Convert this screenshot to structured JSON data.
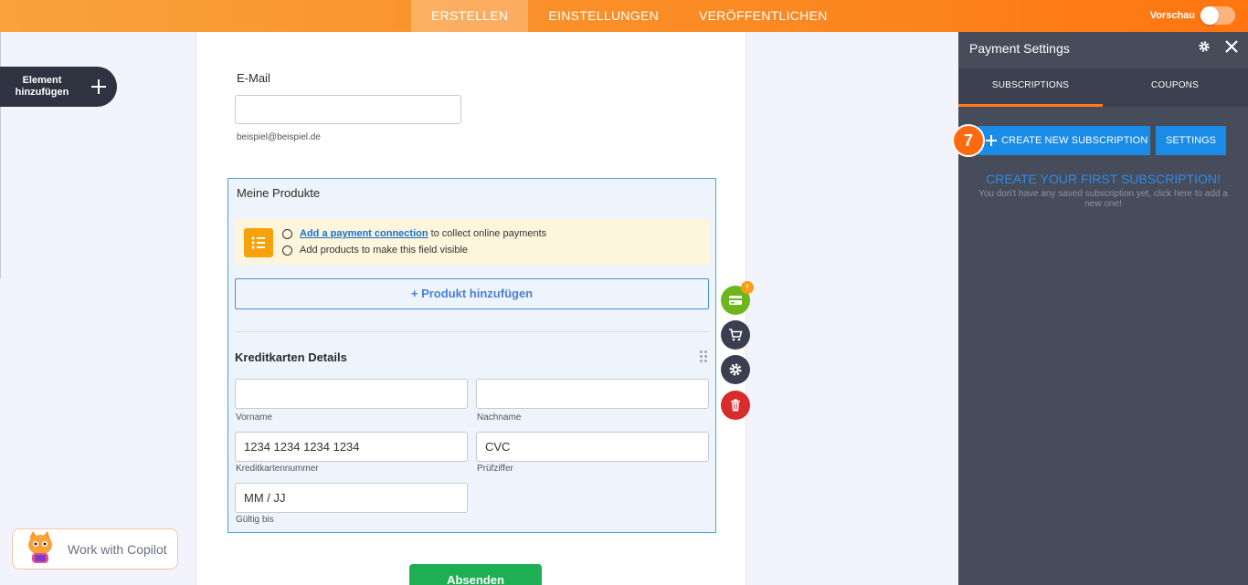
{
  "topbar": {
    "nav": [
      "ERSTELLEN",
      "EINSTELLUNGEN",
      "VERÖFFENTLICHEN"
    ],
    "preview_label": "Vorschau"
  },
  "left": {
    "add_element_label": "Element hinzufügen",
    "copilot_label": "Work with Copilot"
  },
  "form": {
    "email_label": "E-Mail",
    "email_placeholder": "",
    "email_sublabel": "beispiel@beispiel.de",
    "products_title": "Meine Produkte",
    "notice_link": "Add a payment connection",
    "notice_line1_rest": "to collect online payments",
    "notice_line2": "Add products to make this field visible",
    "add_product_label": "+ Produkt hinzufügen",
    "cc_title": "Kreditkarten Details",
    "fields": {
      "first_name_value": "",
      "first_name_label": "Vorname",
      "last_name_value": "",
      "last_name_label": "Nachname",
      "card_number_value": "1234 1234 1234 1234",
      "card_number_label": "Kreditkartennummer",
      "cvc_value": "CVC",
      "cvc_label": "Prüfziffer",
      "expiry_value": "MM / JJ",
      "expiry_label": "Gültig bis"
    },
    "submit_label": "Absenden"
  },
  "tools": {
    "badge": "!"
  },
  "panel": {
    "title": "Payment Settings",
    "tabs": [
      "SUBSCRIPTIONS",
      "COUPONS"
    ],
    "create_button": "CREATE NEW SUBSCRIPTION",
    "settings_button": "SETTINGS",
    "step_number": "7",
    "empty_title": "CREATE YOUR FIRST SUBSCRIPTION!",
    "empty_text": "You don't have any saved subscription yet, click here to add a new one!"
  },
  "colors": {
    "accent_orange": "#fb8a23",
    "panel_bg": "#474c5b",
    "primary_blue": "#1a8be6",
    "submit_green": "#1eaf55"
  }
}
